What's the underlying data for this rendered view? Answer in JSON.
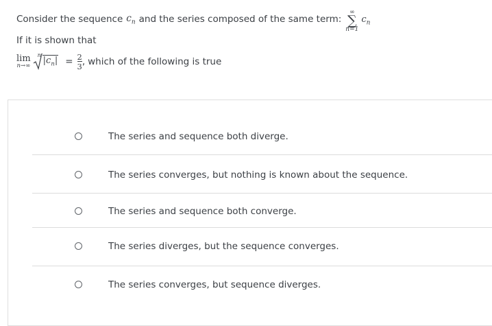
{
  "question": {
    "intro": "Consider the sequence",
    "sequence_term": "c",
    "sequence_sub": "n",
    "intro_mid": "and the series composed of the same term:",
    "sum_upper": "∞",
    "sum_symbol": "∑",
    "sum_lower": "n=1",
    "sum_term": "c",
    "sum_term_sub": "n",
    "given": "If it is shown that",
    "lim_word": "lim",
    "lim_sub": "n→∞",
    "root_index": "n",
    "root_body": "|c",
    "root_body_sub": "n",
    "root_body_end": "|",
    "equals": "=",
    "frac_num": "2",
    "frac_den": "3",
    "comma": ",",
    "tail": "which of the following is true"
  },
  "options": [
    {
      "label": "The series and sequence both diverge."
    },
    {
      "label": "The series converges, but nothing is known about the sequence."
    },
    {
      "label": "The series and sequence both converge."
    },
    {
      "label": "The series diverges, but the sequence converges."
    },
    {
      "label": "The series converges, but sequence diverges."
    }
  ]
}
